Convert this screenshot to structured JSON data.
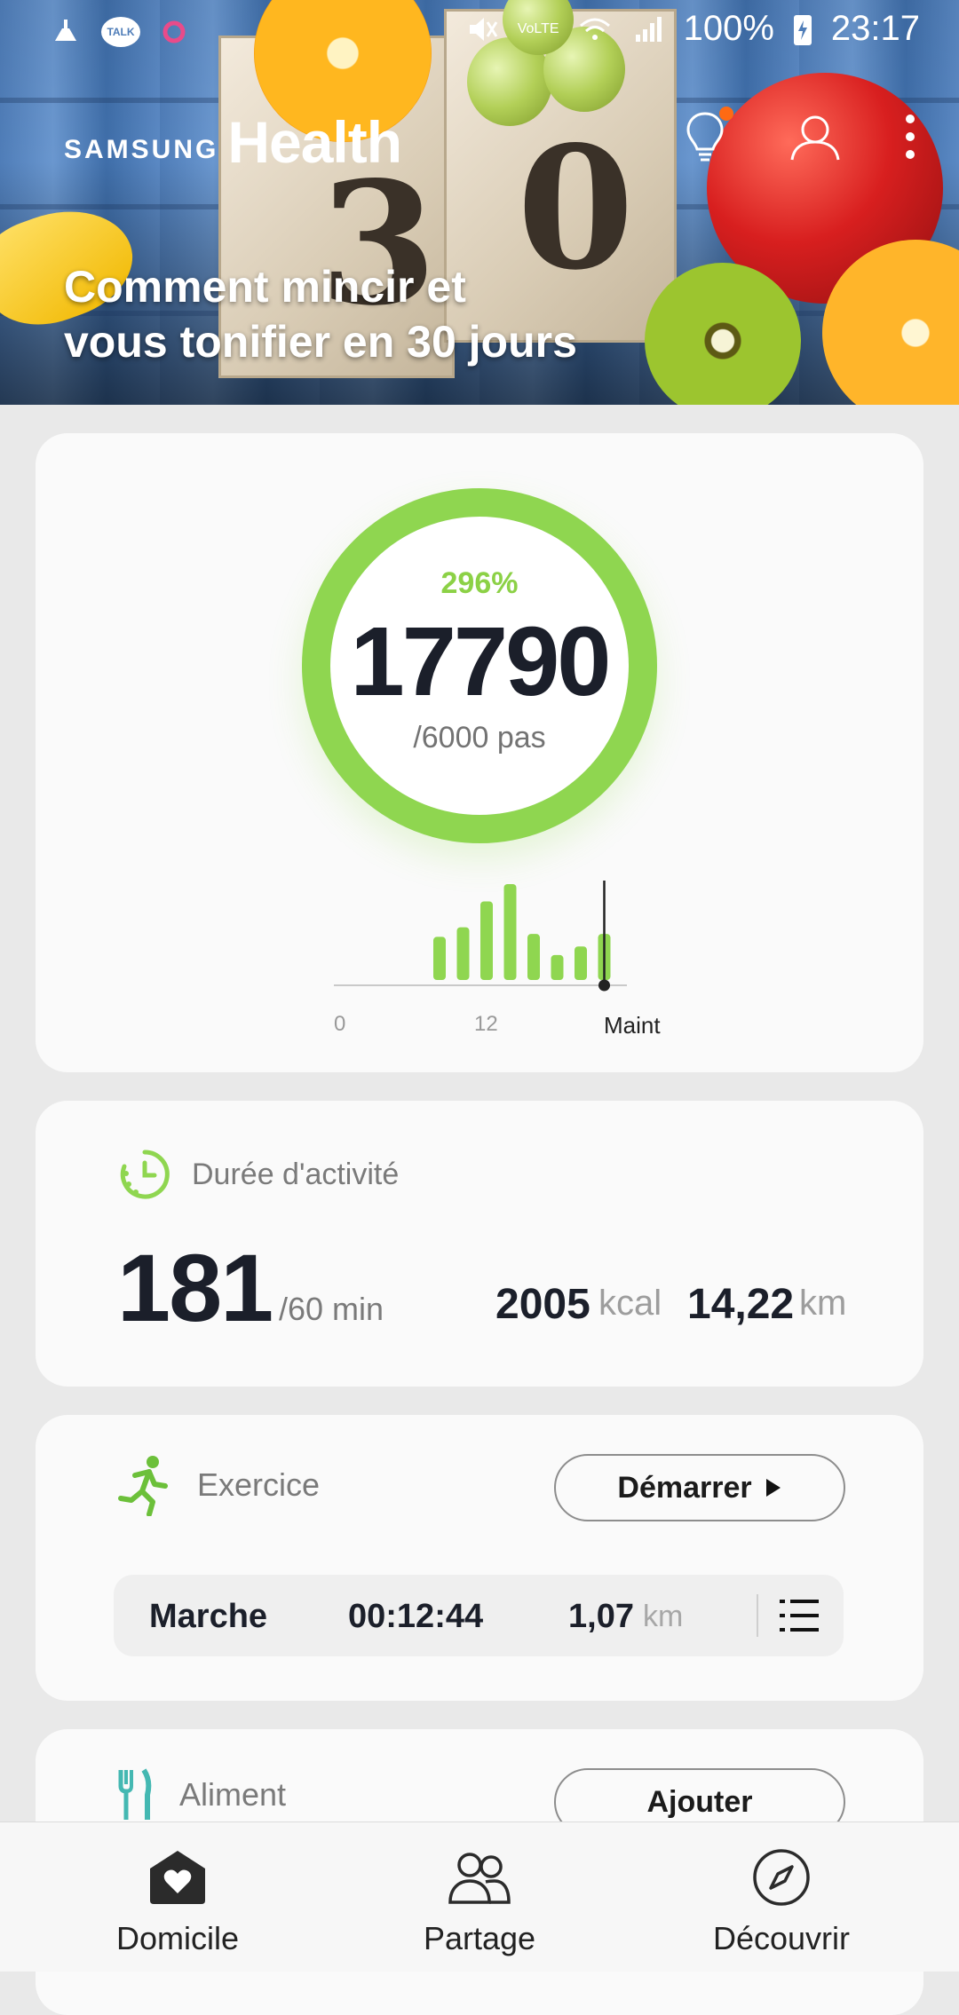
{
  "status_bar": {
    "talk_badge": "TALK",
    "volte": "VoLTE",
    "battery": "100%",
    "time": "23:17"
  },
  "header": {
    "brand_samsung": "SAMSUNG",
    "brand_health": "Health",
    "title_line1": "Comment mincir et",
    "title_line2": "vous tonifier en 30 jours",
    "cube_digit_1": "3",
    "cube_digit_2": "0"
  },
  "steps": {
    "percent": "296%",
    "count": "17790",
    "goal": "/6000 pas",
    "progress_fraction": 1.0,
    "accent_color": "#8fd650"
  },
  "chart_data": {
    "type": "bar",
    "title": "",
    "tick_labels": [
      "0",
      "12",
      "Maint"
    ],
    "values": [
      0.45,
      0.55,
      0.82,
      1.0,
      0.48,
      0.26,
      0.35,
      0.48
    ],
    "current_index": 7,
    "bar_color": "#8fd650"
  },
  "activity": {
    "label": "Durée d'activité",
    "value": "181",
    "unit": "/60 min",
    "kcal_value": "2005",
    "kcal_unit": "kcal",
    "km_value": "14,22",
    "km_unit": "km"
  },
  "exercise": {
    "label": "Exercice",
    "start_button": "Démarrer",
    "row": {
      "type": "Marche",
      "duration": "00:12:44",
      "distance": "1,07",
      "distance_unit": "km"
    }
  },
  "food": {
    "label": "Aliment",
    "add_button": "Ajouter"
  },
  "bottom_nav": {
    "items": [
      {
        "label": "Domicile",
        "icon": "home-heart-icon"
      },
      {
        "label": "Partage",
        "icon": "people-icon"
      },
      {
        "label": "Découvrir",
        "icon": "compass-icon"
      }
    ]
  }
}
